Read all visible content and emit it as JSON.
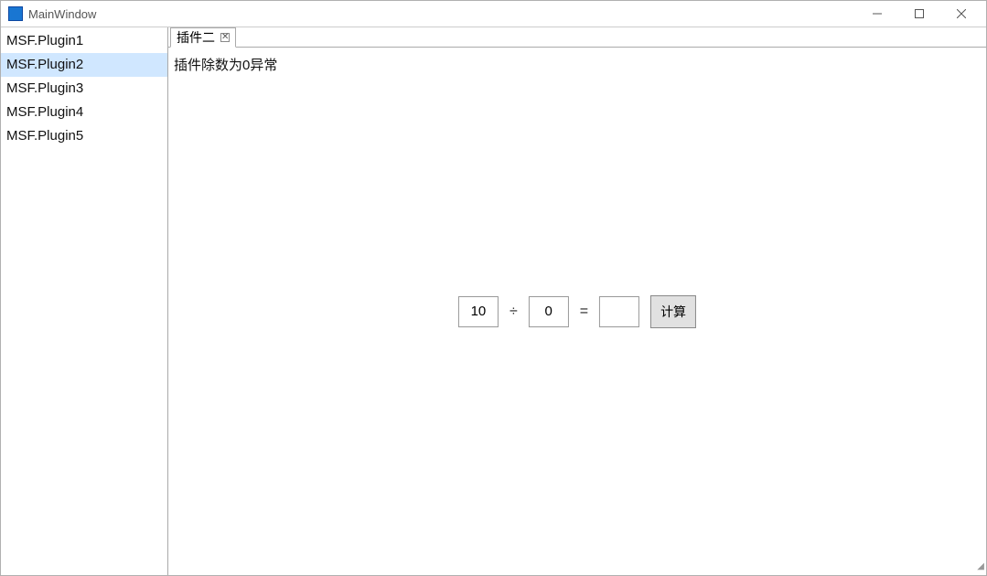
{
  "window": {
    "title": "MainWindow"
  },
  "sidebar": {
    "items": [
      {
        "label": "MSF.Plugin1",
        "selected": false
      },
      {
        "label": "MSF.Plugin2",
        "selected": true
      },
      {
        "label": "MSF.Plugin3",
        "selected": false
      },
      {
        "label": "MSF.Plugin4",
        "selected": false
      },
      {
        "label": "MSF.Plugin5",
        "selected": false
      }
    ]
  },
  "tabs": {
    "active": {
      "label": "插件二"
    }
  },
  "content": {
    "error_message": "插件除数为0异常",
    "calc": {
      "left_value": "10",
      "operator": "÷",
      "right_value": "0",
      "equals": "=",
      "result_value": "",
      "compute_label": "计算"
    }
  }
}
